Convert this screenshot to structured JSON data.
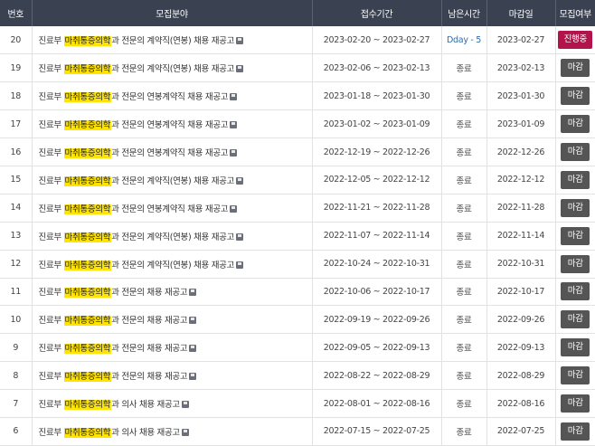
{
  "header": {
    "no": "번호",
    "field": "모집분야",
    "period": "접수기간",
    "remaining": "남은시간",
    "deadline": "마감일",
    "status": "모집여부"
  },
  "rows": [
    {
      "no": "20",
      "prefix": "진료부 ",
      "highlight": "마취통증의학",
      "suffix": "과 전문의 계약직(연봉) 채용 재공고",
      "period": "2023-02-20 ~ 2023-02-27",
      "remaining": "Dday - 5",
      "deadline": "2023-02-27",
      "status": "진행중",
      "open": true
    },
    {
      "no": "19",
      "prefix": "진료부 ",
      "highlight": "마취통증의학",
      "suffix": "과 전문의 계약직(연봉) 채용 재공고",
      "period": "2023-02-06 ~ 2023-02-13",
      "remaining": "종료",
      "deadline": "2023-02-13",
      "status": "마감",
      "open": false
    },
    {
      "no": "18",
      "prefix": "진료부 ",
      "highlight": "마취통증의학",
      "suffix": "과 전문의 연봉계약직 채용 재공고",
      "period": "2023-01-18 ~ 2023-01-30",
      "remaining": "종료",
      "deadline": "2023-01-30",
      "status": "마감",
      "open": false
    },
    {
      "no": "17",
      "prefix": "진료부 ",
      "highlight": "마취통증의학",
      "suffix": "과 전문의 연봉계약직 채용 재공고",
      "period": "2023-01-02 ~ 2023-01-09",
      "remaining": "종료",
      "deadline": "2023-01-09",
      "status": "마감",
      "open": false
    },
    {
      "no": "16",
      "prefix": "진료부 ",
      "highlight": "마취통증의학",
      "suffix": "과 전문의 연봉계약직 채용 재공고",
      "period": "2022-12-19 ~ 2022-12-26",
      "remaining": "종료",
      "deadline": "2022-12-26",
      "status": "마감",
      "open": false
    },
    {
      "no": "15",
      "prefix": "진료부 ",
      "highlight": "마취통증의학",
      "suffix": "과 전문의 계약직(연봉) 채용 재공고",
      "period": "2022-12-05 ~ 2022-12-12",
      "remaining": "종료",
      "deadline": "2022-12-12",
      "status": "마감",
      "open": false
    },
    {
      "no": "14",
      "prefix": "진료부 ",
      "highlight": "마취통증의학",
      "suffix": "과 전문의 연봉계약직 채용 재공고",
      "period": "2022-11-21 ~ 2022-11-28",
      "remaining": "종료",
      "deadline": "2022-11-28",
      "status": "마감",
      "open": false
    },
    {
      "no": "13",
      "prefix": "진료부 ",
      "highlight": "마취통증의학",
      "suffix": "과 전문의 계약직(연봉) 채용 재공고",
      "period": "2022-11-07 ~ 2022-11-14",
      "remaining": "종료",
      "deadline": "2022-11-14",
      "status": "마감",
      "open": false
    },
    {
      "no": "12",
      "prefix": "진료부 ",
      "highlight": "마취통증의학",
      "suffix": "과 전문의 계약직(연봉) 채용 재공고",
      "period": "2022-10-24 ~ 2022-10-31",
      "remaining": "종료",
      "deadline": "2022-10-31",
      "status": "마감",
      "open": false
    },
    {
      "no": "11",
      "prefix": "진료부 ",
      "highlight": "마취통증의학",
      "suffix": "과 전문의 채용 재공고",
      "period": "2022-10-06 ~ 2022-10-17",
      "remaining": "종료",
      "deadline": "2022-10-17",
      "status": "마감",
      "open": false
    },
    {
      "no": "10",
      "prefix": "진료부 ",
      "highlight": "마취통증의학",
      "suffix": "과 전문의 채용 재공고",
      "period": "2022-09-19 ~ 2022-09-26",
      "remaining": "종료",
      "deadline": "2022-09-26",
      "status": "마감",
      "open": false
    },
    {
      "no": "9",
      "prefix": "진료부 ",
      "highlight": "마취통증의학",
      "suffix": "과 전문의 채용 재공고",
      "period": "2022-09-05 ~ 2022-09-13",
      "remaining": "종료",
      "deadline": "2022-09-13",
      "status": "마감",
      "open": false
    },
    {
      "no": "8",
      "prefix": "진료부 ",
      "highlight": "마취통증의학",
      "suffix": "과 전문의 채용 재공고",
      "period": "2022-08-22 ~ 2022-08-29",
      "remaining": "종료",
      "deadline": "2022-08-29",
      "status": "마감",
      "open": false
    },
    {
      "no": "7",
      "prefix": "진료부 ",
      "highlight": "마취통증의학",
      "suffix": "과 의사 채용 재공고",
      "period": "2022-08-01 ~ 2022-08-16",
      "remaining": "종료",
      "deadline": "2022-08-16",
      "status": "마감",
      "open": false
    },
    {
      "no": "6",
      "prefix": "진료부 ",
      "highlight": "마취통증의학",
      "suffix": "과 의사 채용 재공고",
      "period": "2022-07-15 ~ 2022-07-25",
      "remaining": "종료",
      "deadline": "2022-07-25",
      "status": "마감",
      "open": false
    }
  ],
  "icons": {
    "attachment": "file-icon"
  },
  "colors": {
    "header_bg": "#3a4150",
    "highlight": "#ffe400",
    "open_badge": "#b3124a",
    "closed_badge": "#555555",
    "dday_text": "#2b6cb0"
  }
}
